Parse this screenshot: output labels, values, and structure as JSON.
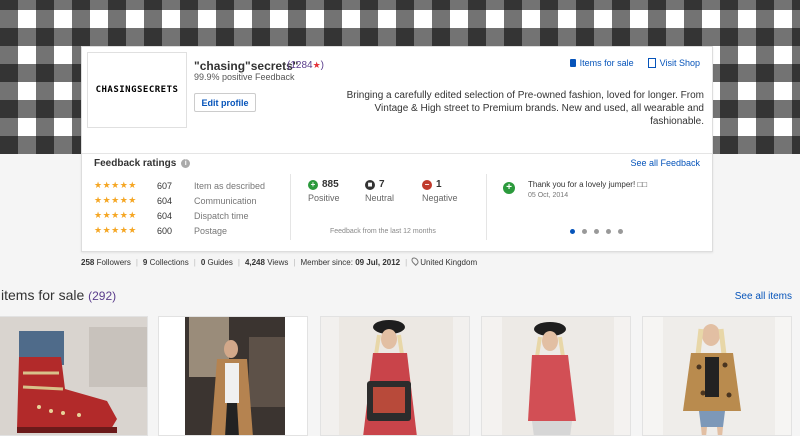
{
  "seller": {
    "name": "\"chasing\"secrets\"",
    "score_open": "(",
    "score": "1284",
    "score_star": "★",
    "score_close": ")",
    "positive_feedback": "99.9% positive Feedback",
    "logo_text": "CHASINGSECRETS",
    "edit_profile": "Edit profile",
    "description": "Bringing a carefully edited selection of Pre-owned fashion, loved for longer. From Vintage & High street to Premium brands. New and used, all wearable and fashionable."
  },
  "links": {
    "items_for_sale": "Items for sale",
    "visit_shop": "Visit Shop"
  },
  "feedback": {
    "title": "Feedback ratings",
    "see_all": "See all Feedback",
    "ratings": [
      {
        "stars": "★★★★★",
        "count": "607",
        "label": "Item as described"
      },
      {
        "stars": "★★★★★",
        "count": "604",
        "label": "Communication"
      },
      {
        "stars": "★★★★★",
        "count": "604",
        "label": "Dispatch time"
      },
      {
        "stars": "★★★★★",
        "count": "600",
        "label": "Postage"
      }
    ],
    "counts": [
      {
        "symbol": "+",
        "value": "885",
        "label": "Positive"
      },
      {
        "symbol": "■",
        "value": "7",
        "label": "Neutral"
      },
      {
        "symbol": "−",
        "value": "1",
        "label": "Negative"
      }
    ],
    "period": "Feedback from the last 12 months",
    "comment": {
      "symbol": "+",
      "text": "Thank you for a lovely jumper! □□",
      "date": "05 Oct, 2014"
    },
    "carousel_pages": 5,
    "carousel_active": 1
  },
  "stats": {
    "followers_num": "258",
    "followers_lbl": "Followers",
    "collections_num": "9",
    "collections_lbl": "Collections",
    "guides_num": "0",
    "guides_lbl": "Guides",
    "views_num": "4,248",
    "views_lbl": "Views",
    "member_lbl": "Member since:",
    "member_date": "09 Jul, 2012",
    "location": "United Kingdom",
    "separator": "|"
  },
  "items_section": {
    "title": "items for sale",
    "count": "(292)",
    "see_all": "See all items"
  },
  "colors": {
    "link": "#0654ba",
    "star": "#f5a623",
    "positive": "#2b9a3c",
    "negative": "#c0392b",
    "score": "#5a3d8c"
  }
}
